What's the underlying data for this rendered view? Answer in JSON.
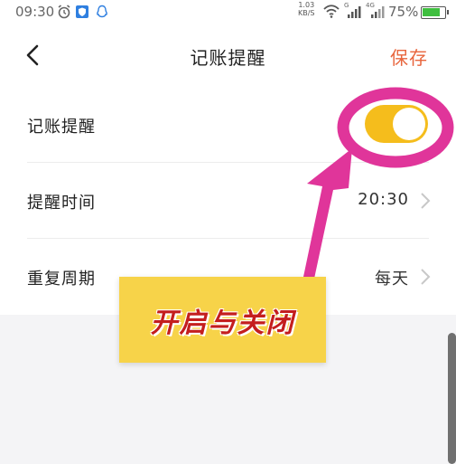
{
  "status_bar": {
    "time": "09:30",
    "net_speed_value": "1.03",
    "net_speed_unit": "KB/S",
    "signal_1_label": "G",
    "signal_2_label": "4G",
    "battery_percent": "75%",
    "battery_level": 0.75,
    "battery_color": "#3fbf3f"
  },
  "nav": {
    "title": "记账提醒",
    "save_label": "保存",
    "accent_color": "#e8653d"
  },
  "settings": {
    "reminder": {
      "label": "记账提醒",
      "enabled": true,
      "toggle_color": "#f5bd1c"
    },
    "time": {
      "label": "提醒时间",
      "value": "20:30"
    },
    "repeat": {
      "label": "重复周期",
      "value": "每天"
    }
  },
  "annotation": {
    "text": "开启与关闭",
    "highlight_color": "#e0359a",
    "box_color": "#f7d349",
    "text_color": "#c41e1e"
  }
}
